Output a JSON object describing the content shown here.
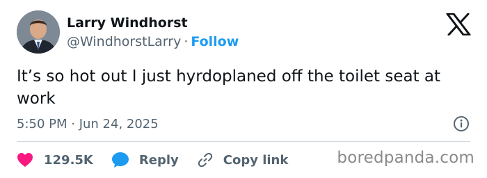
{
  "author": {
    "name": "Larry Windhorst",
    "handle": "@WindhorstLarry",
    "separator": "·",
    "follow_label": "Follow"
  },
  "tweet": {
    "text": "It’s so hot out I just hyrdoplaned off the toilet seat at work",
    "timestamp": "5:50 PM · Jun 24, 2025"
  },
  "actions": {
    "likes": "129.5K",
    "reply_label": "Reply",
    "copy_link_label": "Copy link"
  },
  "icons": {
    "logo": "x-logo-icon",
    "info": "info-icon",
    "like": "heart-icon",
    "reply": "speech-bubble-icon",
    "copy": "link-icon"
  },
  "colors": {
    "like": "#f91880",
    "reply": "#1d9bf0",
    "follow": "#1d9bf0",
    "muted": "#536471"
  },
  "watermark": "boredpanda.com"
}
